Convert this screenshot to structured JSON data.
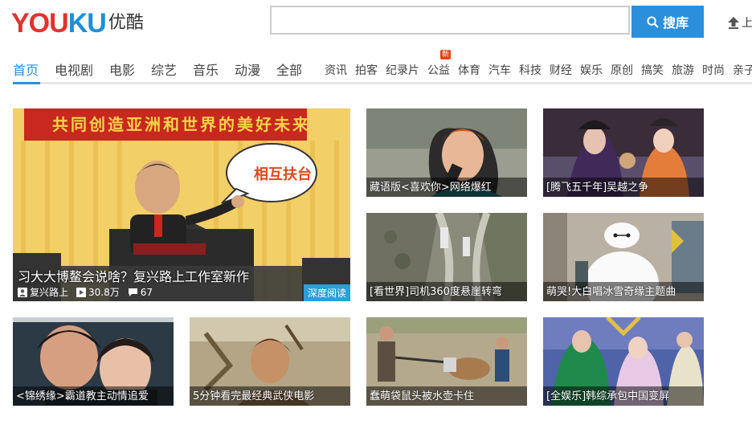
{
  "header": {
    "logo_en_1": "YOU",
    "logo_en_2": "KU",
    "logo_cn": "优酷",
    "search_placeholder": "",
    "search_button": "搜库",
    "upload_label": "上"
  },
  "nav": {
    "main": [
      "首页",
      "电视剧",
      "电影",
      "综艺",
      "音乐",
      "动漫",
      "全部"
    ],
    "sub": [
      "资讯",
      "拍客",
      "纪录片",
      "公益",
      "体育",
      "汽车",
      "科技",
      "财经",
      "娱乐",
      "原创",
      "搞笑",
      "旅游",
      "时尚",
      "亲子"
    ],
    "active": "首页",
    "new_badge": "新"
  },
  "hero": {
    "banner": "共同创造亚洲和世界的美好未来",
    "bubble": "相互扶台",
    "title": "习大大博鳌会说啥？复兴路上工作室新作",
    "author": "复兴路上",
    "plays": "30.8万",
    "comments": "67",
    "tag": "深度阅读"
  },
  "tiles": [
    {
      "caption": "藏语版<喜欢你>网络爆红"
    },
    {
      "caption": "[腾飞五千年]吴越之争"
    },
    {
      "caption": "[看世界]司机360度悬崖转弯"
    },
    {
      "caption": "萌哭!大白唱冰雪奇缘主题曲"
    },
    {
      "caption": "<锦绣缘>霸道教主动情追爱"
    },
    {
      "caption": "5分钟看完最经典武侠电影"
    },
    {
      "caption": "蠢萌袋鼠头被水壶卡住"
    },
    {
      "caption": "[全娱乐]韩综承包中国变屏"
    }
  ],
  "colors": {
    "accent": "#2b8fdc",
    "logo_red": "#e4312d",
    "logo_blue": "#1d8fd8",
    "badge": "#e8430f"
  }
}
